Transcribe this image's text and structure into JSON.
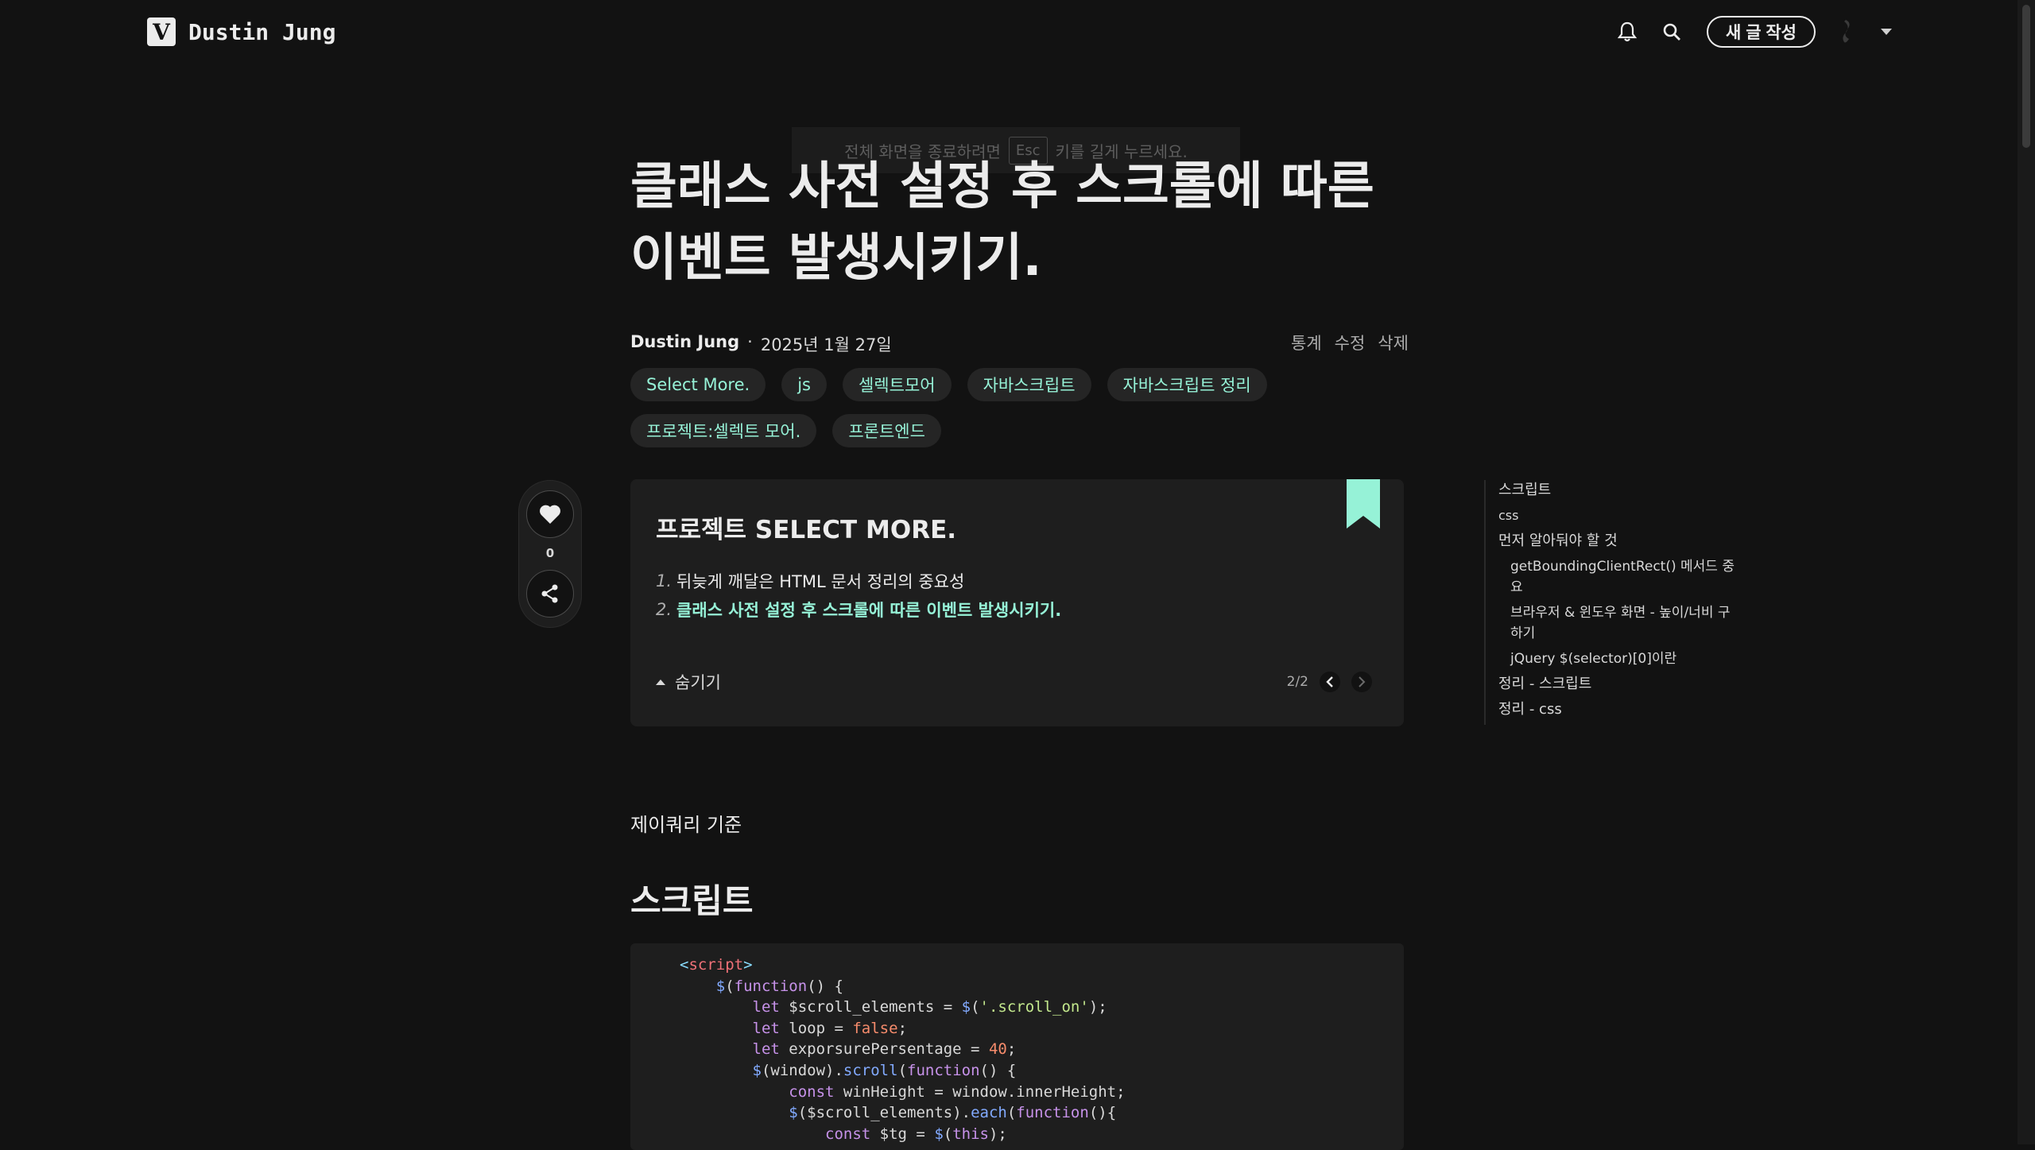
{
  "header": {
    "logo_letter": "V",
    "blog_name": "Dustin Jung",
    "write_button": "새 글 작성"
  },
  "toast": {
    "before": "전체 화면을 종료하려면",
    "key": "Esc",
    "after": "키를 길게 누르세요."
  },
  "post": {
    "title_line1": "클래스 사전 설정 후 스크롤에 따른",
    "title_line2": "이벤트 발생시키기.",
    "author": "Dustin Jung",
    "separator": "·",
    "date": "2025년 1월 27일",
    "actions": [
      "통계",
      "수정",
      "삭제"
    ],
    "tags": [
      "Select More.",
      "js",
      "셀렉트모어",
      "자바스크립트",
      "자바스크립트 정리",
      "프로젝트:셀렉트 모어.",
      "프론트엔드"
    ],
    "like_count": "0"
  },
  "series": {
    "title": "프로젝트 SELECT MORE.",
    "items": [
      {
        "num": "1.",
        "label": "뒤늦게 깨달은 HTML 문서 정리의 중요성"
      },
      {
        "num": "2.",
        "label": "클래스 사전 설정 후 스크롤에 따른 이벤트 발생시키기."
      }
    ],
    "toggle_label": "숨기기",
    "page": "2/2"
  },
  "toc": [
    {
      "label": "스크립트",
      "level": 1
    },
    {
      "label": "css",
      "level": 1
    },
    {
      "label": "먼저 알아둬야 할 것",
      "level": 1
    },
    {
      "label": "getBoundingClientRect() 메서드 중요",
      "level": 2
    },
    {
      "label": "브라우저 & 윈도우 화면 - 높이/너비 구하기",
      "level": 2
    },
    {
      "label": "jQuery $(selector)[0]이란",
      "level": 2
    },
    {
      "label": "정리 - 스크립트",
      "level": 1
    },
    {
      "label": "정리 - css",
      "level": 1
    }
  ],
  "content": {
    "paragraph": "제이쿼리 기준",
    "heading": "스크립트",
    "code_lines": [
      "<script>",
      "    $(function() {",
      "        let $scroll_elements = $('.scroll_on');",
      "        let loop = false;",
      "        let exporsurePersentage = 40;",
      "        $(window).scroll(function() {",
      "            const winHeight = window.innerHeight;",
      "            $($scroll_elements).each(function(){",
      "                const $tg = $(this);"
    ]
  },
  "colors": {
    "background": "#121212",
    "accent": "#96f2d7",
    "surface": "#1e1e1e"
  }
}
